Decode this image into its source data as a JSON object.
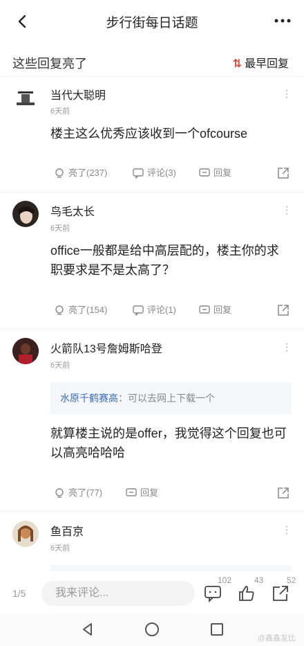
{
  "header": {
    "title": "步行街每日话题",
    "back_icon": "chevron-left-icon",
    "more_icon": "more-dots-icon"
  },
  "section": {
    "label": "这些回复亮了",
    "sort_label": "最早回复"
  },
  "comments": [
    {
      "user": "当代大聪明",
      "time": "6天前",
      "text": "楼主这么优秀应该收到一个ofcourse",
      "likes": "亮了(237)",
      "reply_count": "评论(3)",
      "reply": "回复"
    },
    {
      "user": "鸟毛太长",
      "time": "6天前",
      "text": "office一般都是给中高层配的，楼主你的求职要求是不是太高了？",
      "likes": "亮了(154)",
      "reply_count": "评论(1)",
      "reply": "回复"
    },
    {
      "user": "火箭队13号詹姆斯哈登",
      "time": "6天前",
      "quote_user": "水原千鹤赛高",
      "quote_text": "：可以去网上下载一个",
      "text": "就算楼主说的是offer，我觉得这个回复也可以高亮哈哈哈",
      "likes": "亮了(77)",
      "reply": "回复"
    },
    {
      "user": "鱼百京",
      "time": "6天前"
    }
  ],
  "bottom": {
    "page": "1/5",
    "placeholder": "我来评论...",
    "comment_count": "102",
    "like_count": "43",
    "share_count": "52"
  },
  "watermark": "@鑫鑫发比",
  "colors": {
    "accent_red": "#e0443b",
    "link_blue": "#3a6db8"
  }
}
